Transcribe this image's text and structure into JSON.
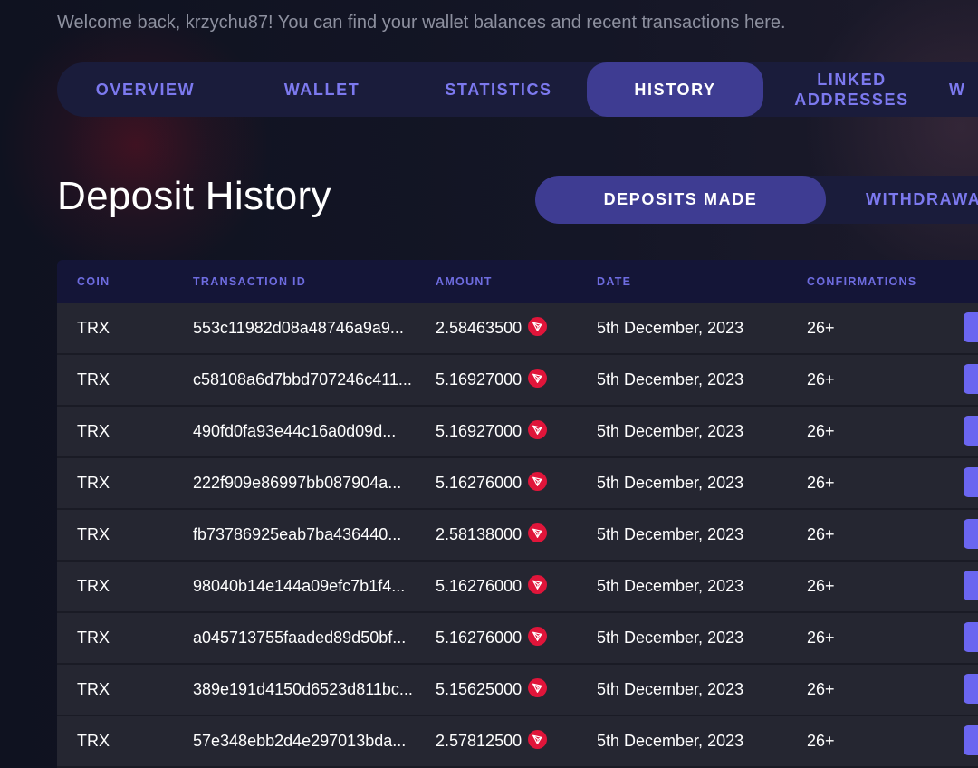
{
  "welcome_text": "Welcome back, krzychu87! You can find your wallet balances and recent transactions here.",
  "tabs": [
    {
      "label": "OVERVIEW"
    },
    {
      "label": "WALLET"
    },
    {
      "label": "STATISTICS"
    },
    {
      "label": "HISTORY",
      "active": true
    },
    {
      "label": "LINKED ADDRESSES"
    },
    {
      "label": "W"
    }
  ],
  "page_title": "Deposit History",
  "subtabs": [
    {
      "label": "DEPOSITS MADE",
      "active": true
    },
    {
      "label": "WITHDRAWA"
    }
  ],
  "table": {
    "headers": {
      "coin": "COIN",
      "txid": "TRANSACTION ID",
      "amount": "AMOUNT",
      "date": "DATE",
      "confirmations": "CONFIRMATIONS"
    },
    "rows": [
      {
        "coin": "TRX",
        "txid": "553c11982d08a48746a9a9...",
        "amount": "2.58463500",
        "date": "5th December, 2023",
        "confirmations": "26+"
      },
      {
        "coin": "TRX",
        "txid": "c58108a6d7bbd707246c411...",
        "amount": "5.16927000",
        "date": "5th December, 2023",
        "confirmations": "26+"
      },
      {
        "coin": "TRX",
        "txid": "490fd0fa93e44c16a0d09d...",
        "amount": "5.16927000",
        "date": "5th December, 2023",
        "confirmations": "26+"
      },
      {
        "coin": "TRX",
        "txid": "222f909e86997bb087904a...",
        "amount": "5.16276000",
        "date": "5th December, 2023",
        "confirmations": "26+"
      },
      {
        "coin": "TRX",
        "txid": "fb73786925eab7ba436440...",
        "amount": "2.58138000",
        "date": "5th December, 2023",
        "confirmations": "26+"
      },
      {
        "coin": "TRX",
        "txid": "98040b14e144a09efc7b1f4...",
        "amount": "5.16276000",
        "date": "5th December, 2023",
        "confirmations": "26+"
      },
      {
        "coin": "TRX",
        "txid": "a045713755faaded89d50bf...",
        "amount": "5.16276000",
        "date": "5th December, 2023",
        "confirmations": "26+"
      },
      {
        "coin": "TRX",
        "txid": "389e191d4150d6523d811bc...",
        "amount": "5.15625000",
        "date": "5th December, 2023",
        "confirmations": "26+"
      },
      {
        "coin": "TRX",
        "txid": "57e348ebb2d4e297013bda...",
        "amount": "2.57812500",
        "date": "5th December, 2023",
        "confirmations": "26+"
      }
    ]
  },
  "icons": {
    "amount_coin_icon": "tron-icon"
  },
  "colors": {
    "accent": "#7c79ef",
    "active_pill": "#3e3c92",
    "tron_red": "#e0153a"
  }
}
